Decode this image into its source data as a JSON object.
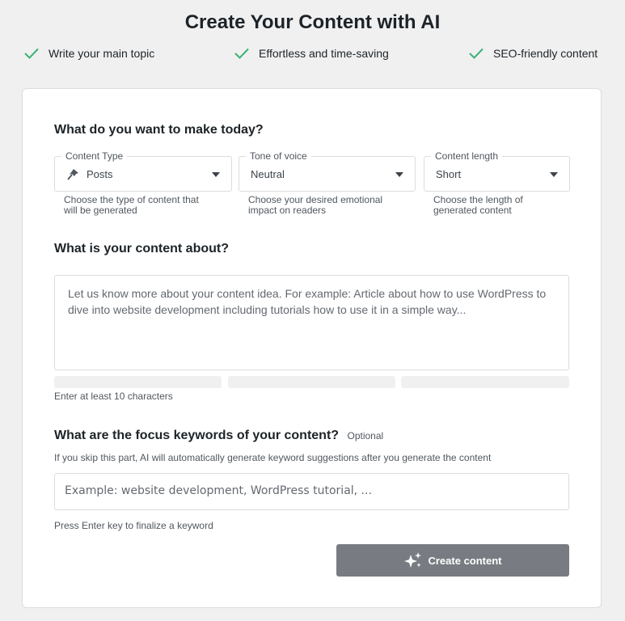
{
  "header": {
    "title": "Create Your Content with AI",
    "features": [
      {
        "label": "Write your main topic",
        "icon": "check-icon"
      },
      {
        "label": "Effortless and time-saving",
        "icon": "check-icon"
      },
      {
        "label": "SEO-friendly content",
        "icon": "check-icon"
      }
    ]
  },
  "form": {
    "make_heading": "What do you want to make today?",
    "content_type": {
      "label": "Content Type",
      "value": "Posts",
      "icon": "pin-icon",
      "help": [
        "Choose the type of content that",
        "will be generated"
      ]
    },
    "tone": {
      "label": "Tone of voice",
      "value": "Neutral",
      "help": [
        "Choose your desired emotional",
        "impact on readers"
      ]
    },
    "length": {
      "label": "Content length",
      "value": "Short",
      "help": [
        "Choose the length of",
        "generated content"
      ]
    },
    "about_heading": "What is your content about?",
    "about_placeholder": "Let us know more about your content idea. For example: Article about how to use WordPress to dive into website development including tutorials how to use it in a simple way...",
    "about_note": "Enter at least 10 characters",
    "keywords_heading": "What are the focus keywords of your content?",
    "keywords_optional": "Optional",
    "keywords_desc": "If you skip this part, AI will automatically generate keyword suggestions after you generate the content",
    "keywords_placeholder": "Example: website development, WordPress tutorial, ...",
    "keywords_note": "Press Enter key to finalize a keyword",
    "create_label": "Create content"
  },
  "colors": {
    "check": "#3bb273",
    "button": "#787c82",
    "background": "#f0f0f1"
  }
}
